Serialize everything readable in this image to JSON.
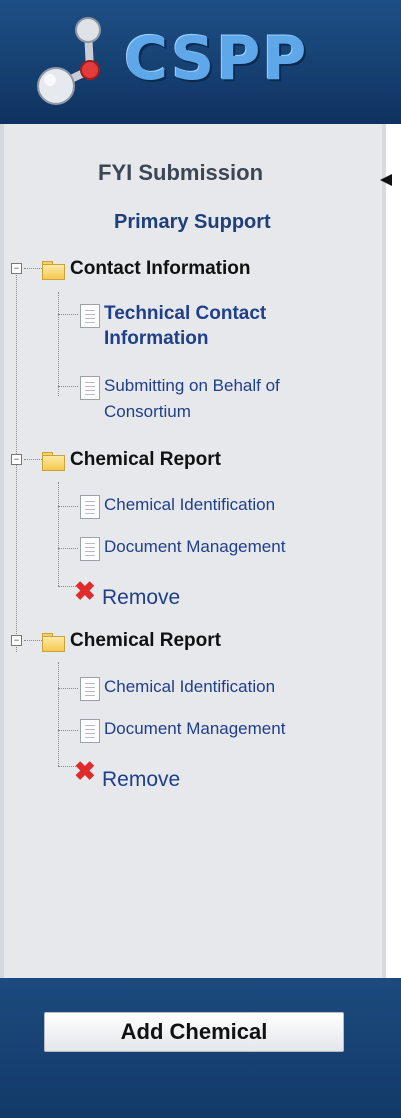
{
  "header": {
    "logo_text": "CSPP"
  },
  "panel": {
    "title": "FYI Submission",
    "subtitle": "Primary Support"
  },
  "tree": {
    "contact": {
      "label": "Contact Information",
      "items": [
        {
          "label_line1": "Technical Contact",
          "label_line2": "Information"
        },
        {
          "label_line1": "Submitting on Behalf of",
          "label_line2": "Consortium"
        }
      ]
    },
    "reports": [
      {
        "label": "Chemical Report",
        "items": [
          "Chemical Identification",
          "Document Management"
        ],
        "remove": "Remove"
      },
      {
        "label": "Chemical Report",
        "items": [
          "Chemical Identification",
          "Document Management"
        ],
        "remove": "Remove"
      }
    ]
  },
  "footer": {
    "add_button": "Add Chemical"
  },
  "icons": {
    "expander": "minus-box-icon",
    "folder": "folder-icon",
    "document": "document-icon",
    "remove": "red-x-icon",
    "arrow": "collapse-arrow-icon"
  },
  "colors": {
    "header_bg": "#1d4f86",
    "panel_bg": "#e6e8ec",
    "link": "#1f3f8a",
    "remove_x": "#e02b2b",
    "folder": "#f4c94e"
  }
}
